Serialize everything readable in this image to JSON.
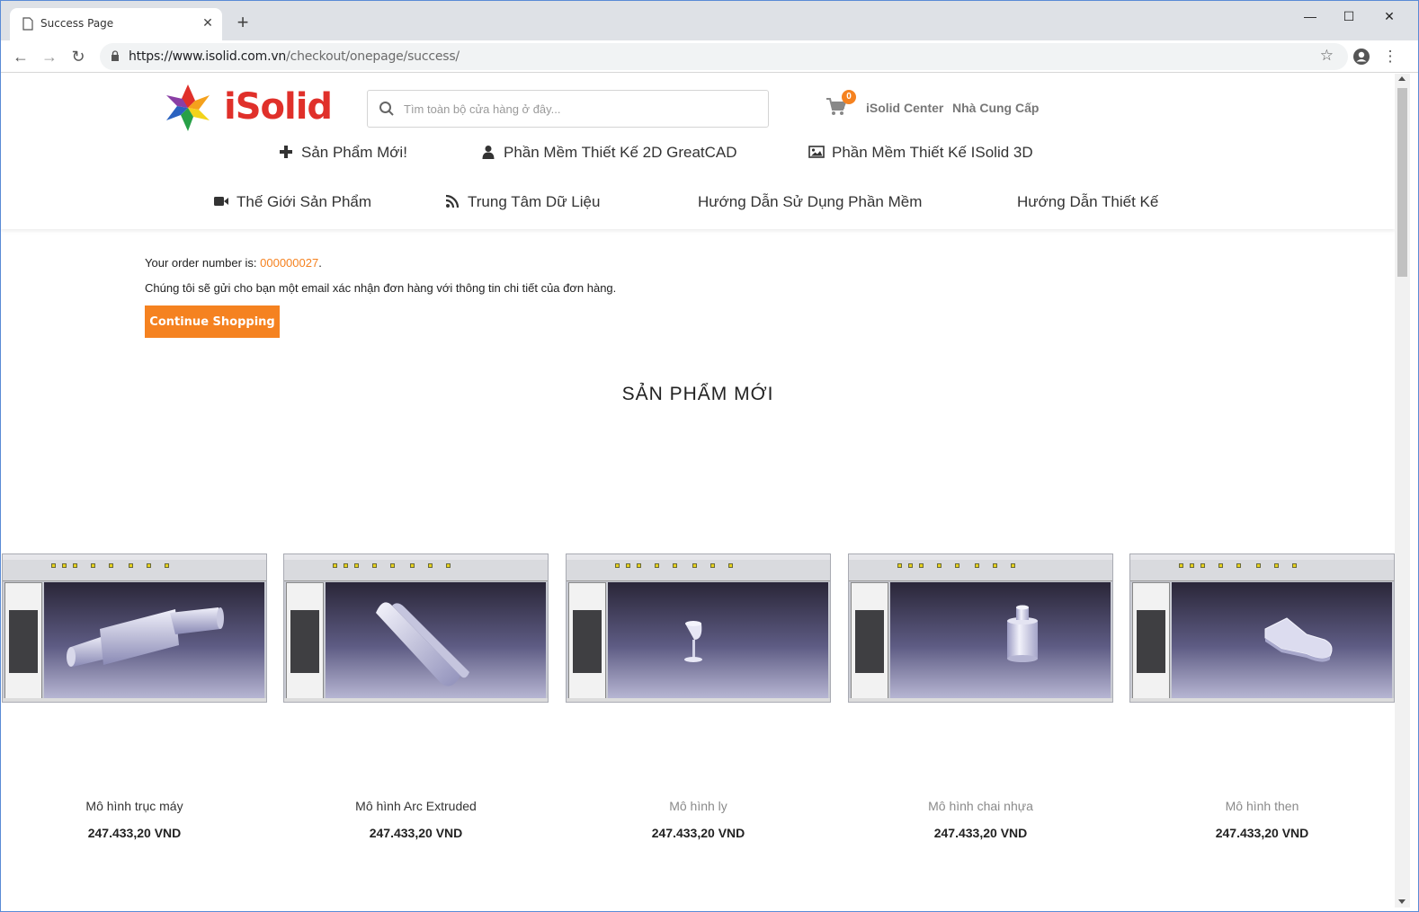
{
  "browser": {
    "tab_title": "Success Page",
    "url_host": "https://www.isolid.com.vn",
    "url_path": "/checkout/onepage/success/"
  },
  "header": {
    "logo_text": "iSolid",
    "search_placeholder": "Tìm toàn bộ cửa hàng ở đây...",
    "cart_count": "0",
    "link_center": "iSolid Center",
    "link_supplier": "Nhà Cung Cấp"
  },
  "menu": {
    "row1": [
      {
        "label": "Sản Phẩm Mới!",
        "icon": "plus-icon"
      },
      {
        "label": "Phần Mềm Thiết Kế 2D GreatCAD",
        "icon": "user-icon"
      },
      {
        "label": "Phần Mềm Thiết Kế ISolid 3D",
        "icon": "image-icon"
      }
    ],
    "row2": [
      {
        "label": "Thế Giới Sản Phẩm",
        "icon": "video-icon"
      },
      {
        "label": "Trung Tâm Dữ Liệu",
        "icon": "rss-icon"
      },
      {
        "label": "Hướng Dẫn Sử Dụng Phần Mềm"
      },
      {
        "label": "Hướng Dẫn Thiết Kế"
      }
    ]
  },
  "success": {
    "order_prefix": "Your order number is: ",
    "order_number": "000000027",
    "order_suffix": ".",
    "email_message": "Chúng tôi sẽ gửi cho bạn một email xác nhận đơn hàng với thông tin chi tiết của đơn hàng.",
    "continue_label": "Continue Shopping"
  },
  "new_products": {
    "title": "SẢN PHẨM MỚI",
    "items": [
      {
        "name": "Mô hình trục máy",
        "price": "247.433,20 VND"
      },
      {
        "name": "Mô hình Arc Extruded",
        "price": "247.433,20 VND"
      },
      {
        "name": "Mô hình ly",
        "price": "247.433,20 VND"
      },
      {
        "name": "Mô hình chai nhựa",
        "price": "247.433,20 VND"
      },
      {
        "name": "Mô hình then",
        "price": "247.433,20 VND"
      }
    ]
  },
  "colors": {
    "accent": "#f58220",
    "logo_red": "#e0302a"
  }
}
